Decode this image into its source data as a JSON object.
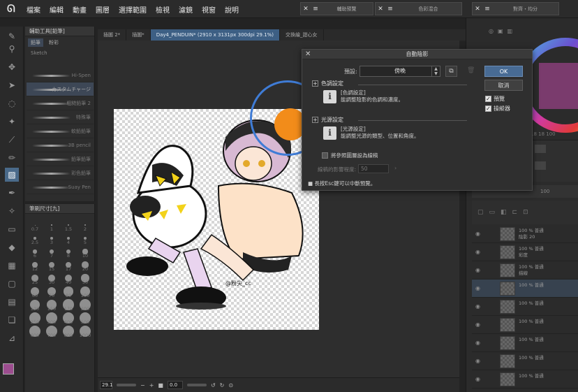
{
  "menu": {
    "items": [
      "檔案",
      "編輯",
      "動畫",
      "圖層",
      "選擇範圍",
      "檢視",
      "濾鏡",
      "視窗",
      "說明"
    ]
  },
  "floating_panels": [
    {
      "title": "輔助預覽"
    },
    {
      "title": "色彩混合"
    },
    {
      "title": "對齊・均分"
    }
  ],
  "subtool": {
    "header": "輔助工具[鉛筆]",
    "tabs": [
      "鉛筆",
      "粉彩"
    ],
    "group_label": "Sketch",
    "brushes": [
      "Hi-Spen",
      "カスタムチャージ",
      "粗糙鉛筆 2",
      "特殊筆",
      "軟鉛鉛筆",
      "3B pencil",
      "鉛筆鉛筆",
      "彩色鉛筆",
      "Suay Pen"
    ]
  },
  "brush_size": {
    "header": "筆刷尺寸[九]",
    "numbers": [
      "0.7",
      "1",
      "1.5",
      "2",
      "2.5",
      "3",
      "4",
      "5",
      "6",
      "7",
      "8",
      "10",
      "12",
      "15",
      "17",
      "20",
      "25",
      "30",
      "40",
      "50",
      "60",
      "70",
      "80",
      "100",
      "120",
      "150",
      "170",
      "200",
      "250",
      "300",
      "400",
      "500",
      "600",
      "700",
      "800",
      "1000"
    ]
  },
  "doc_tabs": [
    {
      "label": "插圖 2*",
      "active": false
    },
    {
      "label": "插圖*",
      "active": false
    },
    {
      "label": "Day4_PENDUIN* (2910 x 3131px 300dpi 29.1%)",
      "active": true
    },
    {
      "label": "交換繪_甜心女",
      "active": false
    }
  ],
  "canvas": {
    "signature": "@粉尖_cc"
  },
  "status": {
    "zoom": "29.1",
    "angle": "0.0"
  },
  "dialog": {
    "title": "自動陰影",
    "preset_label": "預設:",
    "preset_value": "傍晚",
    "ok": "OK",
    "cancel": "取消",
    "preview_label": "預覽",
    "manipulator_label": "操縱器",
    "color_section": {
      "title": "色調設定",
      "heading": "[色調設定]",
      "desc": "能調整陰影的色調和濃度。"
    },
    "light_section": {
      "title": "光源設定",
      "heading": "[光源設定]",
      "desc": "能調整光源的類型、位置和角度。"
    },
    "ref_layer_label": "將參照圖層設為線稿",
    "line_influence_label": "線稿的影響程度:",
    "line_influence_value": "50",
    "hint": "■ 長按Esc鍵可以中斷預覽。"
  },
  "right_panel": {
    "color_values": "18 18 100",
    "opacity": "100",
    "layers": [
      {
        "label1": "100 % 普通",
        "label2": "陰影 20"
      },
      {
        "label1": "100 % 普通",
        "label2": "彩度"
      },
      {
        "label1": "100 % 普通",
        "label2": "描線"
      },
      {
        "label1": "100 % 普通",
        "label2": ""
      },
      {
        "label1": "100 % 普通",
        "label2": ""
      },
      {
        "label1": "100 % 普通",
        "label2": ""
      },
      {
        "label1": "100 % 普通",
        "label2": ""
      },
      {
        "label1": "100 % 普通",
        "label2": ""
      },
      {
        "label1": "100 % 普通",
        "label2": ""
      }
    ]
  },
  "colors": {
    "accent": "#486b94",
    "tab_active": "#3d5f84",
    "orange": "#f28c1a",
    "brush_circle": "#3f7cd6",
    "main_color": "#9c4d8f"
  }
}
